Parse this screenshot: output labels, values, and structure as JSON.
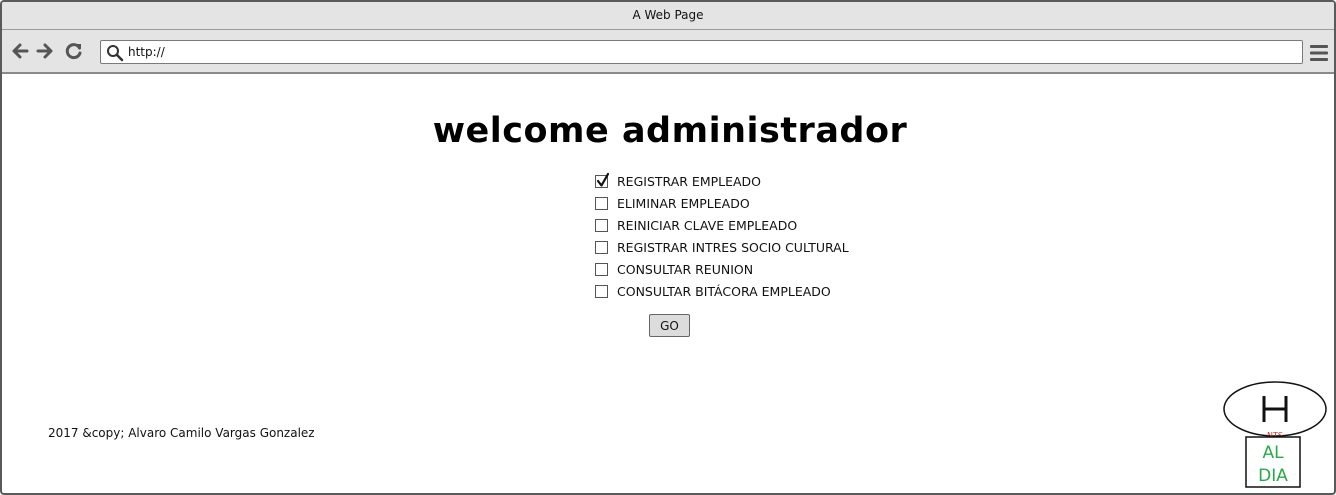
{
  "window": {
    "title": "A Web Page"
  },
  "browser": {
    "url": "http://",
    "icons": {
      "back": "arrow-left-icon",
      "forward": "arrow-right-icon",
      "reload": "reload-icon",
      "search": "search-icon",
      "menu": "hamburger-menu-icon"
    }
  },
  "main": {
    "heading": "welcome administrador",
    "options": [
      {
        "label": "REGISTRAR EMPLEADO",
        "checked": true
      },
      {
        "label": "ELIMINAR EMPLEADO",
        "checked": false
      },
      {
        "label": "REINICIAR CLAVE EMPLEADO",
        "checked": false
      },
      {
        "label": "REGISTRAR INTRES SOCIO CULTURAL",
        "checked": false
      },
      {
        "label": "CONSULTAR REUNION",
        "checked": false
      },
      {
        "label": "CONSULTAR BITÁCORA EMPLEADO",
        "checked": false
      }
    ],
    "go_label": "GO"
  },
  "footer": {
    "copyright": "2017 &copy; Alvaro Camilo Vargas Gonzalez"
  },
  "logo": {
    "letter": "H",
    "small_text": "NTS",
    "line1": "AL",
    "line2": "DIA"
  },
  "colors": {
    "chrome": "#e4e4e4",
    "logo_green": "#2aa84a",
    "logo_red": "#c0392b"
  }
}
